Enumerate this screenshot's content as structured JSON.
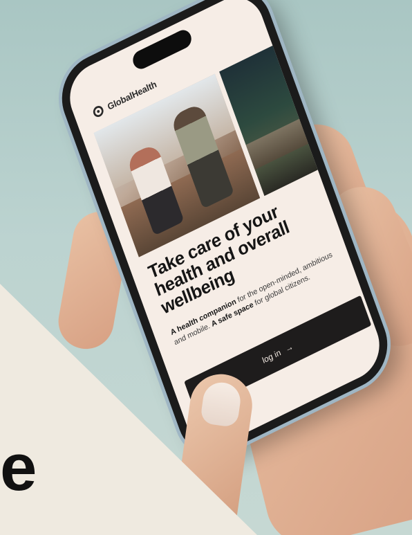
{
  "app": {
    "brand_name": "GlobalHealth",
    "logo_icon": "globalhealth-logo-icon"
  },
  "hero": {
    "headline": "Take care of your health and overall wellbeing",
    "tagline_parts": [
      {
        "text": "A health companion",
        "bold": true
      },
      {
        "text": " for the open-minded, ambitious and mobile. ",
        "bold": false
      },
      {
        "text": "A safe space",
        "bold": true
      },
      {
        "text": " for global citizens.",
        "bold": false
      }
    ]
  },
  "actions": {
    "login_label": "log in",
    "login_arrow": "→"
  },
  "overlay": {
    "corner_glyph": "e"
  },
  "colors": {
    "screen_bg": "#f6ede6",
    "button_bg": "#1e1c1c",
    "background_teal": "#b4cdca",
    "cream_panel": "#efeae0"
  }
}
